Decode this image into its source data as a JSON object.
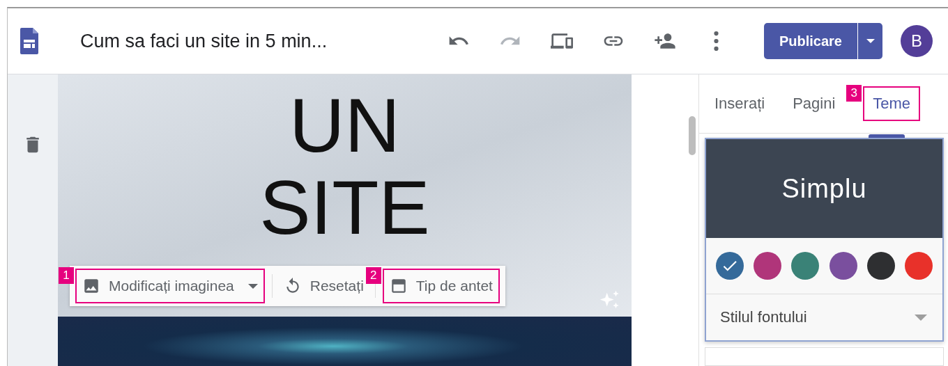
{
  "header": {
    "title": "Cum sa faci un site in 5 min...",
    "undo_disabled": false,
    "redo_disabled": true,
    "publish_label": "Publicare",
    "avatar_letter": "B"
  },
  "banner": {
    "title_lines": [
      "UN",
      "SITE"
    ]
  },
  "image_toolbar": [
    {
      "kind": "dropdown",
      "label": "Modificați imaginea",
      "callout": "1"
    },
    {
      "kind": "reset",
      "label": "Resetați"
    },
    {
      "kind": "header-type",
      "label": "Tip de antet",
      "callout": "2"
    }
  ],
  "tabs": [
    {
      "label": "Inserați",
      "selected": false
    },
    {
      "label": "Pagini",
      "selected": false
    },
    {
      "label": "Teme",
      "selected": true,
      "callout": "3"
    }
  ],
  "theme": {
    "name": "Simplu",
    "font_style": "Stilul fontului",
    "swatches": [
      {
        "color": "#356a9a",
        "selected": true
      },
      {
        "color": "#b0357a",
        "selected": false
      },
      {
        "color": "#3a8277",
        "selected": false
      },
      {
        "color": "#7a4f9e",
        "selected": false
      },
      {
        "color": "#2e2f31",
        "selected": false
      },
      {
        "color": "#e8312a",
        "selected": false
      }
    ]
  }
}
